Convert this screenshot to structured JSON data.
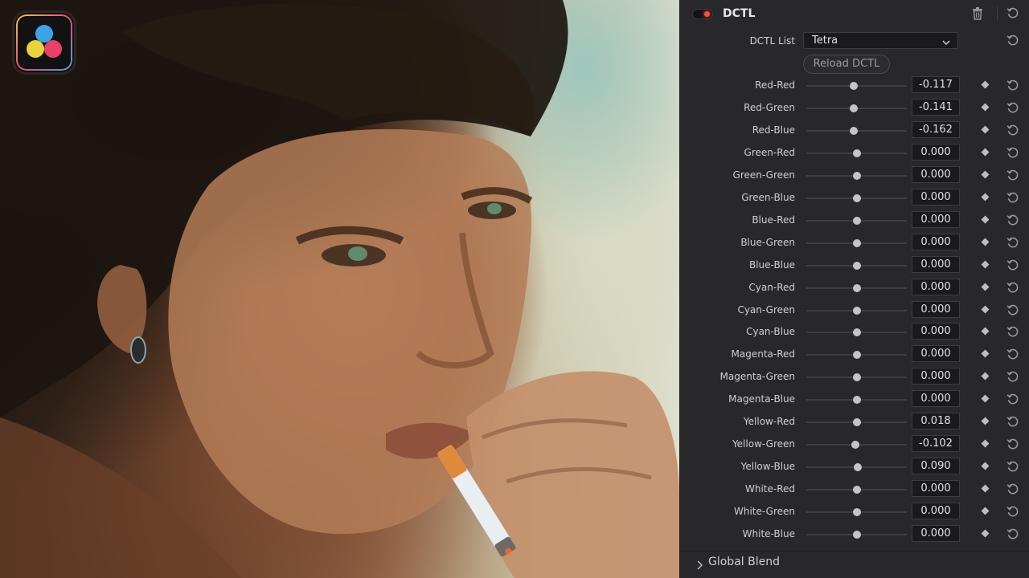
{
  "app": {
    "logo_icon": "davinci-resolve-logo-icon"
  },
  "panel": {
    "title": "DCTL",
    "enabled": true,
    "dctl_list_label": "DCTL List",
    "dctl_list_value": "Tetra",
    "reload_label": "Reload DCTL",
    "global_blend_label": "Global Blend",
    "params": [
      {
        "label": "Red-Red",
        "value": "-0.117",
        "slider_position": 0.472
      },
      {
        "label": "Red-Green",
        "value": "-0.141",
        "slider_position": 0.472
      },
      {
        "label": "Red-Blue",
        "value": "-0.162",
        "slider_position": 0.472
      },
      {
        "label": "Green-Red",
        "value": "0.000",
        "slider_position": 0.5
      },
      {
        "label": "Green-Green",
        "value": "0.000",
        "slider_position": 0.5
      },
      {
        "label": "Green-Blue",
        "value": "0.000",
        "slider_position": 0.5
      },
      {
        "label": "Blue-Red",
        "value": "0.000",
        "slider_position": 0.5
      },
      {
        "label": "Blue-Green",
        "value": "0.000",
        "slider_position": 0.5
      },
      {
        "label": "Blue-Blue",
        "value": "0.000",
        "slider_position": 0.5
      },
      {
        "label": "Cyan-Red",
        "value": "0.000",
        "slider_position": 0.5
      },
      {
        "label": "Cyan-Green",
        "value": "0.000",
        "slider_position": 0.5
      },
      {
        "label": "Cyan-Blue",
        "value": "0.000",
        "slider_position": 0.5
      },
      {
        "label": "Magenta-Red",
        "value": "0.000",
        "slider_position": 0.5
      },
      {
        "label": "Magenta-Green",
        "value": "0.000",
        "slider_position": 0.5
      },
      {
        "label": "Magenta-Blue",
        "value": "0.000",
        "slider_position": 0.5
      },
      {
        "label": "Yellow-Red",
        "value": "0.018",
        "slider_position": 0.5
      },
      {
        "label": "Yellow-Green",
        "value": "-0.102",
        "slider_position": 0.484
      },
      {
        "label": "Yellow-Blue",
        "value": "0.090",
        "slider_position": 0.508
      },
      {
        "label": "White-Red",
        "value": "0.000",
        "slider_position": 0.5
      },
      {
        "label": "White-Green",
        "value": "0.000",
        "slider_position": 0.5
      },
      {
        "label": "White-Blue",
        "value": "0.000",
        "slider_position": 0.5
      }
    ]
  },
  "colors": {
    "panel_bg": "#28282b",
    "enabled_indicator": "#ff4a3d",
    "field_bg": "#1a1a1c"
  }
}
